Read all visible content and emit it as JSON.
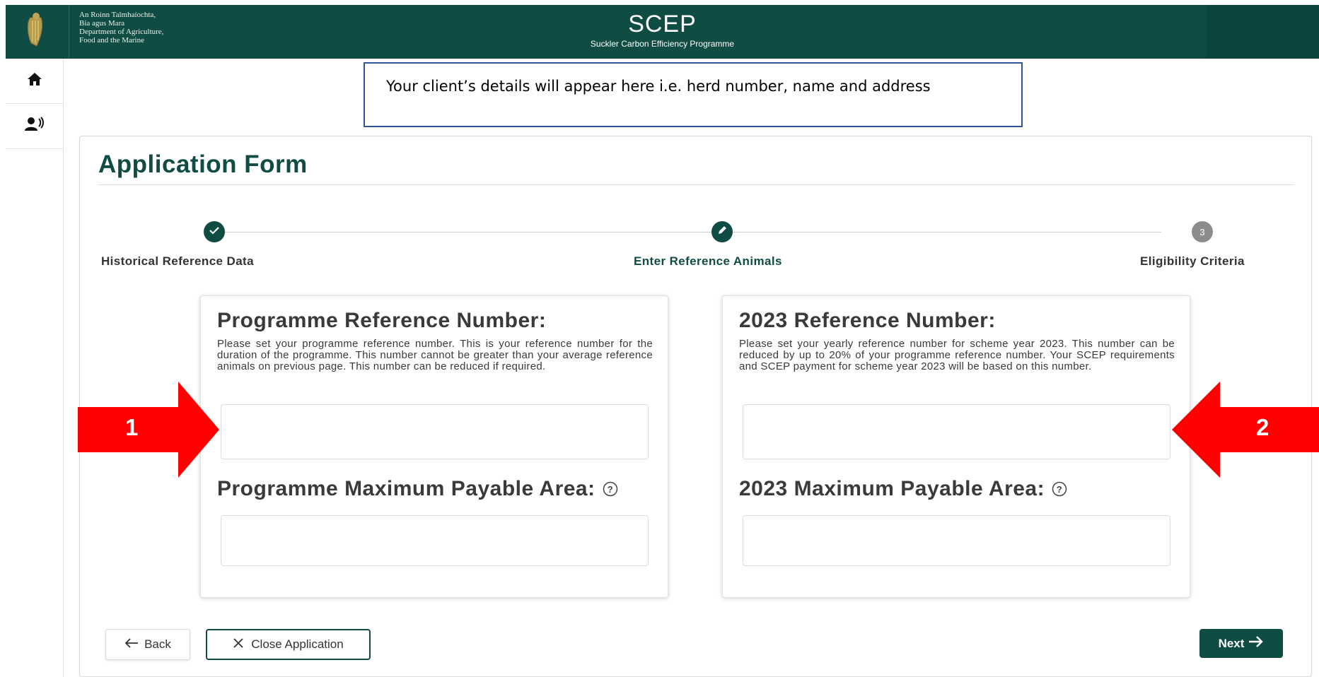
{
  "header": {
    "dept_lines": [
      "An Roinn Talmhaíochta,",
      "Bia agus Mara",
      "Department of Agriculture,",
      "Food and the Marine"
    ],
    "app_title": "SCEP",
    "app_subtitle": "Suckler Carbon Efficiency Programme"
  },
  "sidebar": {
    "items": [
      {
        "icon": "home-icon"
      },
      {
        "icon": "user-speaking-icon"
      }
    ]
  },
  "client_box": {
    "text": "Your client’s details will appear here i.e. herd number, name and address"
  },
  "page": {
    "title": "Application Form"
  },
  "stepper": {
    "steps": [
      {
        "label": "Historical Reference Data",
        "state": "done",
        "marker": ""
      },
      {
        "label": "Enter Reference Animals",
        "state": "active",
        "marker": ""
      },
      {
        "label": "Eligibility Criteria",
        "state": "pending",
        "marker": "3"
      }
    ]
  },
  "panels": {
    "programme": {
      "heading": "Programme Reference Number:",
      "description": "Please set your programme reference number. This is your reference number for the duration of the programme. This number cannot be greater than your average reference animals on previous page. This number can be reduced if required.",
      "input_value": "",
      "area_heading": "Programme Maximum Payable Area:",
      "area_value": ""
    },
    "year": {
      "heading": "2023 Reference Number:",
      "description": "Please set your yearly reference number for scheme year 2023. This number can be reduced by up to 20% of your programme reference number. Your SCEP requirements and SCEP payment for scheme year 2023 will be based on this number.",
      "input_value": "",
      "area_heading": "2023 Maximum Payable Area:",
      "area_value": ""
    }
  },
  "buttons": {
    "back": "Back",
    "close": "Close Application",
    "next": "Next"
  },
  "annotations": {
    "arrow1": "1",
    "arrow2": "2",
    "color": "#ff0000"
  },
  "colors": {
    "brand": "#0f4d44",
    "client_box_border": "#2f5597"
  }
}
